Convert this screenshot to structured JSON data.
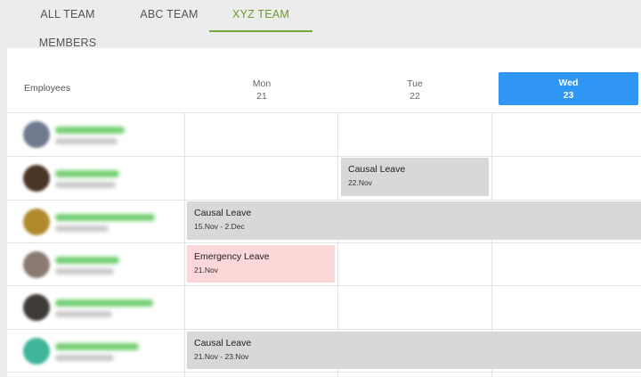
{
  "tabs": [
    {
      "label": "ALL TEAM MEMBERS"
    },
    {
      "label": "ABC TEAM"
    },
    {
      "label": "XYZ TEAM"
    }
  ],
  "active_tab": "XYZ TEAM",
  "accent_color": "#72a83a",
  "today_color": "#2f96f3",
  "calendar": {
    "employees_header": "Employees",
    "days": [
      {
        "name": "Mon",
        "date": "21"
      },
      {
        "name": "Tue",
        "date": "22"
      },
      {
        "name": "Wed",
        "date": "23"
      }
    ],
    "today": "Wed"
  },
  "leaves": [
    {
      "type": "Causal Leave",
      "dates": "22.Nov"
    },
    {
      "type": "Causal Leave",
      "dates": "15.Nov - 2.Dec"
    },
    {
      "type": "Emergency Leave",
      "dates": "21.Nov"
    },
    {
      "type": "Causal Leave",
      "dates": "21.Nov - 23.Nov"
    }
  ]
}
